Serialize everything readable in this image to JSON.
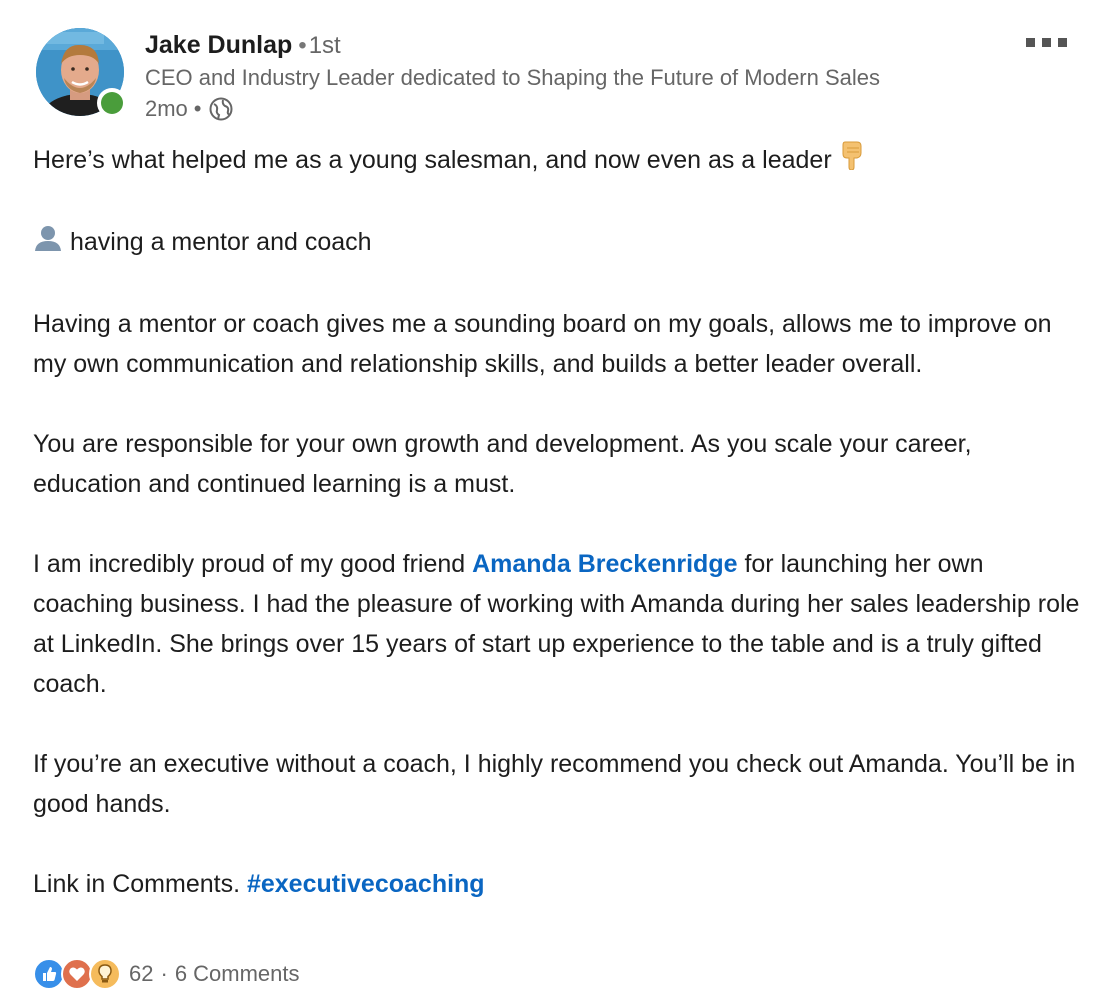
{
  "author": {
    "name": "Jake Dunlap",
    "degree_separator": "•",
    "degree": "1st",
    "headline": "CEO and Industry Leader dedicated to Shaping the Future of Modern Sales",
    "time": "2mo",
    "time_separator": "•",
    "visibility_icon": "globe-icon",
    "presence": "online",
    "presence_color": "#4a9d3b"
  },
  "post": {
    "line1": "Here’s what helped me as a young salesman, and now even as a leader",
    "line1_emoji": "pointing-down-emoji",
    "line2_emoji": "person-silhouette-emoji",
    "line2": "having a mentor and coach",
    "para3": "Having a mentor or coach gives me a sounding board on my goals, allows me to improve on my own communication and relationship skills, and builds a better leader overall.",
    "para4": "You are responsible for your own growth and development. As you scale your career, education and continued learning is a must.",
    "para5_before": "I am incredibly proud of my good friend ",
    "para5_mention": "Amanda Breckenridge",
    "para5_after": " for launching her own coaching business. I had the pleasure of working with Amanda during her sales leadership role at LinkedIn. She brings over 15 years of start up experience to the table and is a truly gifted coach.",
    "para6": "If you’re an executive without a coach, I highly recommend you check out Amanda. You’ll be in good hands.",
    "para7_before": "Link in Comments. ",
    "para7_hashtag": "#executivecoaching"
  },
  "social": {
    "reactions": [
      "like-icon",
      "love-icon",
      "insightful-icon"
    ],
    "reaction_count": "62",
    "separator": "·",
    "comments": "6 Comments"
  },
  "colors": {
    "link": "#0a66c2",
    "text": "#1d1d1d",
    "muted": "#666666",
    "like": "#378fe9",
    "love": "#df704d",
    "insightful": "#f5bb5c"
  }
}
